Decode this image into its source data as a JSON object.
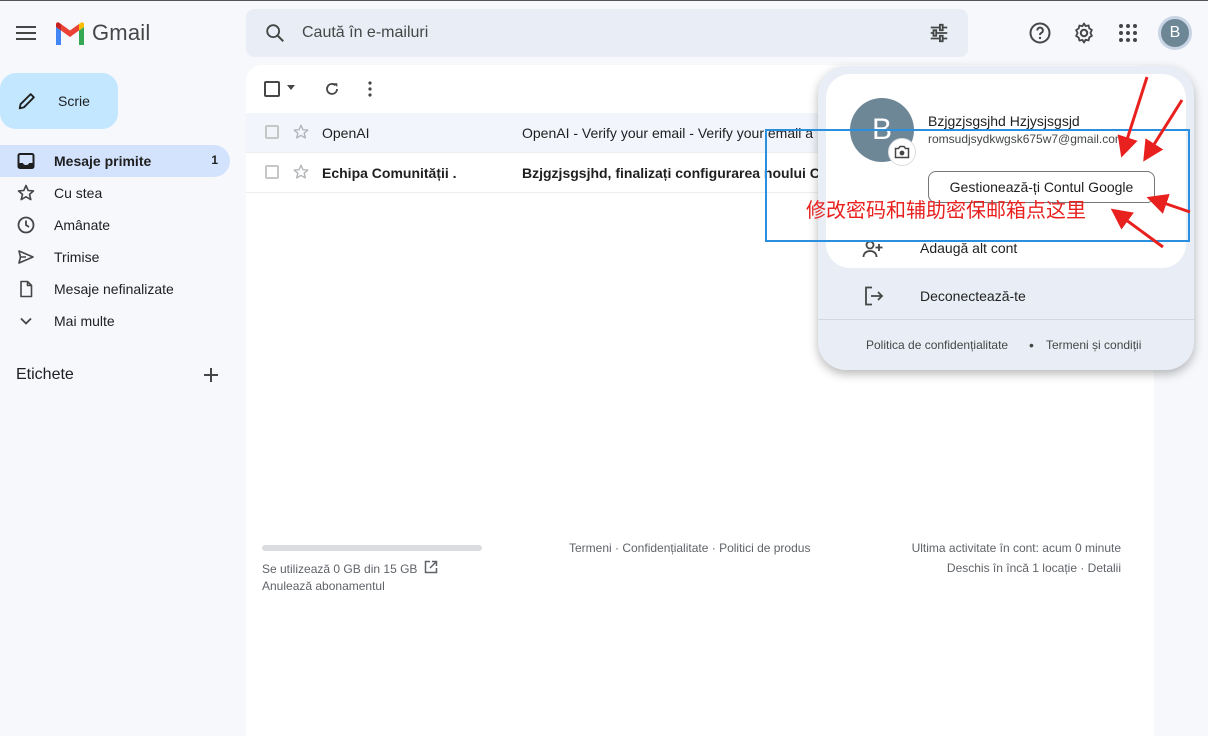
{
  "app": {
    "name": "Gmail"
  },
  "search": {
    "placeholder": "Caută în e-mailuri"
  },
  "avatar_letter": "B",
  "compose": {
    "label": "Scrie"
  },
  "nav": [
    {
      "label": "Mesaje primite",
      "count": "1",
      "icon": "inbox-icon",
      "active": true
    },
    {
      "label": "Cu stea",
      "icon": "star-icon"
    },
    {
      "label": "Amânate",
      "icon": "clock-icon"
    },
    {
      "label": "Trimise",
      "icon": "send-icon"
    },
    {
      "label": "Mesaje nefinalizate",
      "icon": "draft-icon"
    },
    {
      "label": "Mai multe",
      "icon": "chevron-down-icon"
    }
  ],
  "labels_header": "Etichete",
  "emails": [
    {
      "sender": "OpenAI",
      "subject": "OpenAI - Verify your email - Verify your email a",
      "unread": false
    },
    {
      "sender": "Echipa Comunității .",
      "subject": "Bzjgzjsgsjhd, finalizați configurarea noului C",
      "unread": true
    }
  ],
  "footer": {
    "storage": "Se utilizează 0 GB din 15 GB",
    "cancel": "Anulează abonamentul",
    "links": "Termeni · Confidențialitate · Politici de produs",
    "activity": "Ultima activitate în cont: acum 0 minute",
    "details": "Deschis în încă 1 locație · Detalii"
  },
  "account": {
    "letter": "B",
    "name": "Bzjgzjsgsjhd Hzjysjsgsjd",
    "email": "romsudjsydkwgsk675w7@gmail.com",
    "manage": "Gestionează-ți Contul Google",
    "add": "Adaugă alt cont",
    "logout": "Deconectează-te",
    "privacy": "Politica de confidențialitate",
    "terms": "Termeni și condiții"
  },
  "annotation": {
    "text": "修改密码和辅助密保邮箱点这里",
    "color": "#e8211f",
    "box_color": "#2b8fe0"
  },
  "colors": {
    "compose_bg": "#c2e7ff",
    "active_nav": "#d3e3fd",
    "search_bg": "#e9eef6",
    "avatar": "#6e8797"
  }
}
